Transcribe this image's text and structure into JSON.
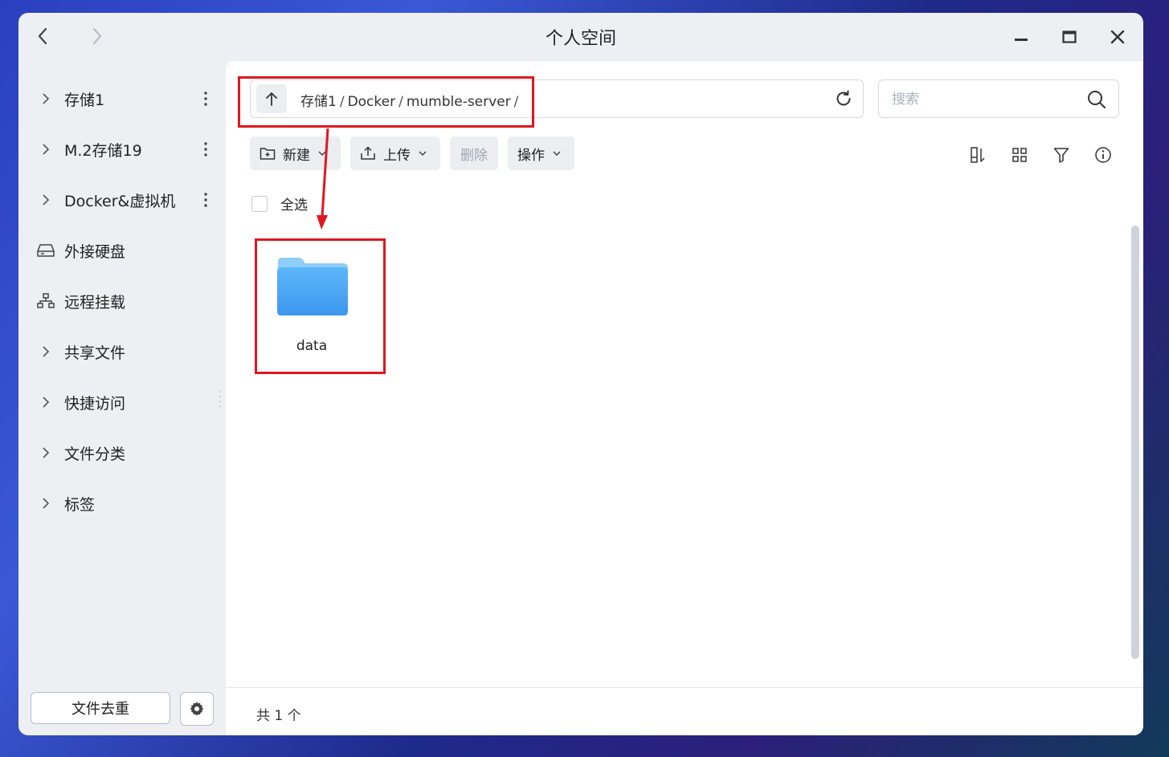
{
  "window": {
    "title": "个人空间"
  },
  "sidebar": {
    "items": [
      {
        "label": "存储1",
        "icon": "chevron-right-icon",
        "has_more": true
      },
      {
        "label": "M.2存储19",
        "icon": "chevron-right-icon",
        "has_more": true
      },
      {
        "label": "Docker&虚拟机",
        "icon": "chevron-right-icon",
        "has_more": true
      },
      {
        "label": "外接硬盘",
        "icon": "external-drive-icon",
        "has_more": false
      },
      {
        "label": "远程挂载",
        "icon": "network-mount-icon",
        "has_more": false
      },
      {
        "label": "共享文件",
        "icon": "chevron-right-icon",
        "has_more": false
      },
      {
        "label": "快捷访问",
        "icon": "chevron-right-icon",
        "has_more": false
      },
      {
        "label": "文件分类",
        "icon": "chevron-right-icon",
        "has_more": false
      },
      {
        "label": "标签",
        "icon": "chevron-right-icon",
        "has_more": false
      }
    ],
    "dedup_button": "文件去重"
  },
  "path": {
    "segments": [
      "存储1",
      "Docker",
      "mumble-server"
    ],
    "separator": "/"
  },
  "search": {
    "placeholder": "搜索",
    "value": ""
  },
  "toolbar": {
    "new_label": "新建",
    "upload_label": "上传",
    "delete_label": "删除",
    "actions_label": "操作"
  },
  "select_all": "全选",
  "files": [
    {
      "name": "data",
      "type": "folder"
    }
  ],
  "status": {
    "count_text": "共 1 个"
  },
  "colors": {
    "annotation_red": "#e0171f",
    "folder_blue": "#4aa8f5",
    "sidebar_bg": "#eeeff3"
  }
}
